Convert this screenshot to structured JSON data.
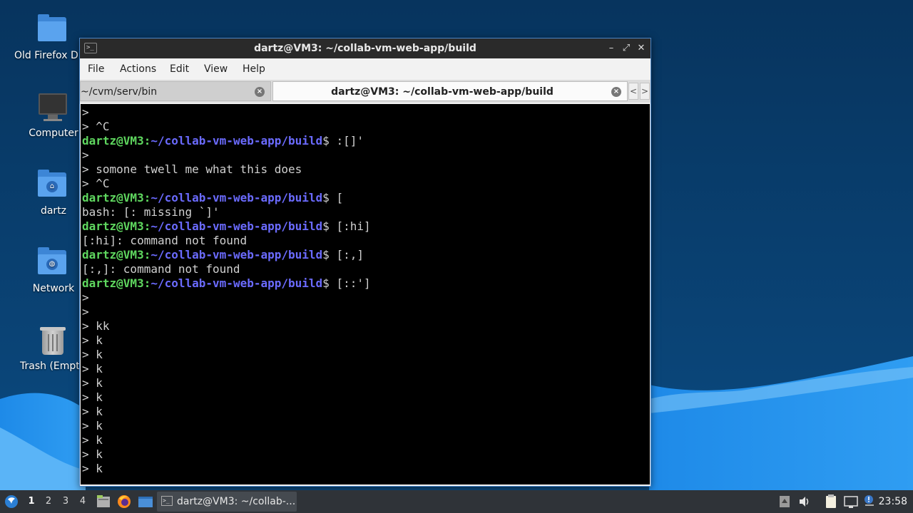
{
  "desktop": {
    "icons": [
      {
        "label": "Old Firefox D",
        "icon": "folder-icon"
      },
      {
        "label": "Computer",
        "icon": "computer-icon"
      },
      {
        "label": "dartz",
        "icon": "home-folder-icon"
      },
      {
        "label": "Network",
        "icon": "network-folder-icon"
      },
      {
        "label": "Trash (Empt",
        "icon": "trash-icon"
      }
    ]
  },
  "window": {
    "title": "dartz@VM3: ~/collab-vm-web-app/build",
    "controls": {
      "minimize": "–",
      "maximize": "⤢",
      "close": "✕"
    },
    "menu": [
      "File",
      "Actions",
      "Edit",
      "View",
      "Help"
    ],
    "tabs": [
      {
        "label": "~/cvm/serv/bin",
        "active": false
      },
      {
        "label": "dartz@VM3: ~/collab-vm-web-app/build",
        "active": true
      }
    ],
    "tab_nav": {
      "prev": "<",
      "next": ">"
    }
  },
  "terminal": {
    "prompt_user": "dartz@VM3",
    "prompt_path": "~/collab-vm-web-app/build",
    "lines": [
      {
        "text": ">"
      },
      {
        "text": "> ^C"
      },
      {
        "prompt": true,
        "cmd": " :[]'"
      },
      {
        "text": ">"
      },
      {
        "text": "> somone twell me what this does"
      },
      {
        "text": "> ^C"
      },
      {
        "prompt": true,
        "cmd": " ["
      },
      {
        "text": "bash: [: missing `]'"
      },
      {
        "prompt": true,
        "cmd": " [:hi]"
      },
      {
        "text": "[:hi]: command not found"
      },
      {
        "prompt": true,
        "cmd": " [:,]"
      },
      {
        "text": "[:,]: command not found"
      },
      {
        "prompt": true,
        "cmd": " [::']"
      },
      {
        "text": ">"
      },
      {
        "text": ">"
      },
      {
        "text": "> kk"
      },
      {
        "text": "> k"
      },
      {
        "text": "> k"
      },
      {
        "text": "> k"
      },
      {
        "text": "> k"
      },
      {
        "text": "> k"
      },
      {
        "text": "> k"
      },
      {
        "text": "> k"
      },
      {
        "text": "> k"
      },
      {
        "text": "> k"
      },
      {
        "text": "> k"
      }
    ]
  },
  "taskbar": {
    "workspaces": [
      "1",
      "2",
      "3",
      "4"
    ],
    "current_workspace": "1",
    "launchers": [
      "file-manager-icon",
      "firefox-icon",
      "desktop-icon"
    ],
    "task_label": "dartz@VM3: ~/collab-...",
    "tray": [
      "tray-up-icon",
      "volume-icon",
      "clipboard-icon",
      "network-monitor-icon",
      "notification-icon"
    ],
    "clock": "23:58"
  },
  "colors": {
    "desktop_bg": "#0c3a66",
    "wave_light": "#2a96f0",
    "terminal_bg": "#000000",
    "prompt_user": "#5fd75f",
    "prompt_path": "#6b6bff",
    "window_border": "#4a86c8"
  }
}
